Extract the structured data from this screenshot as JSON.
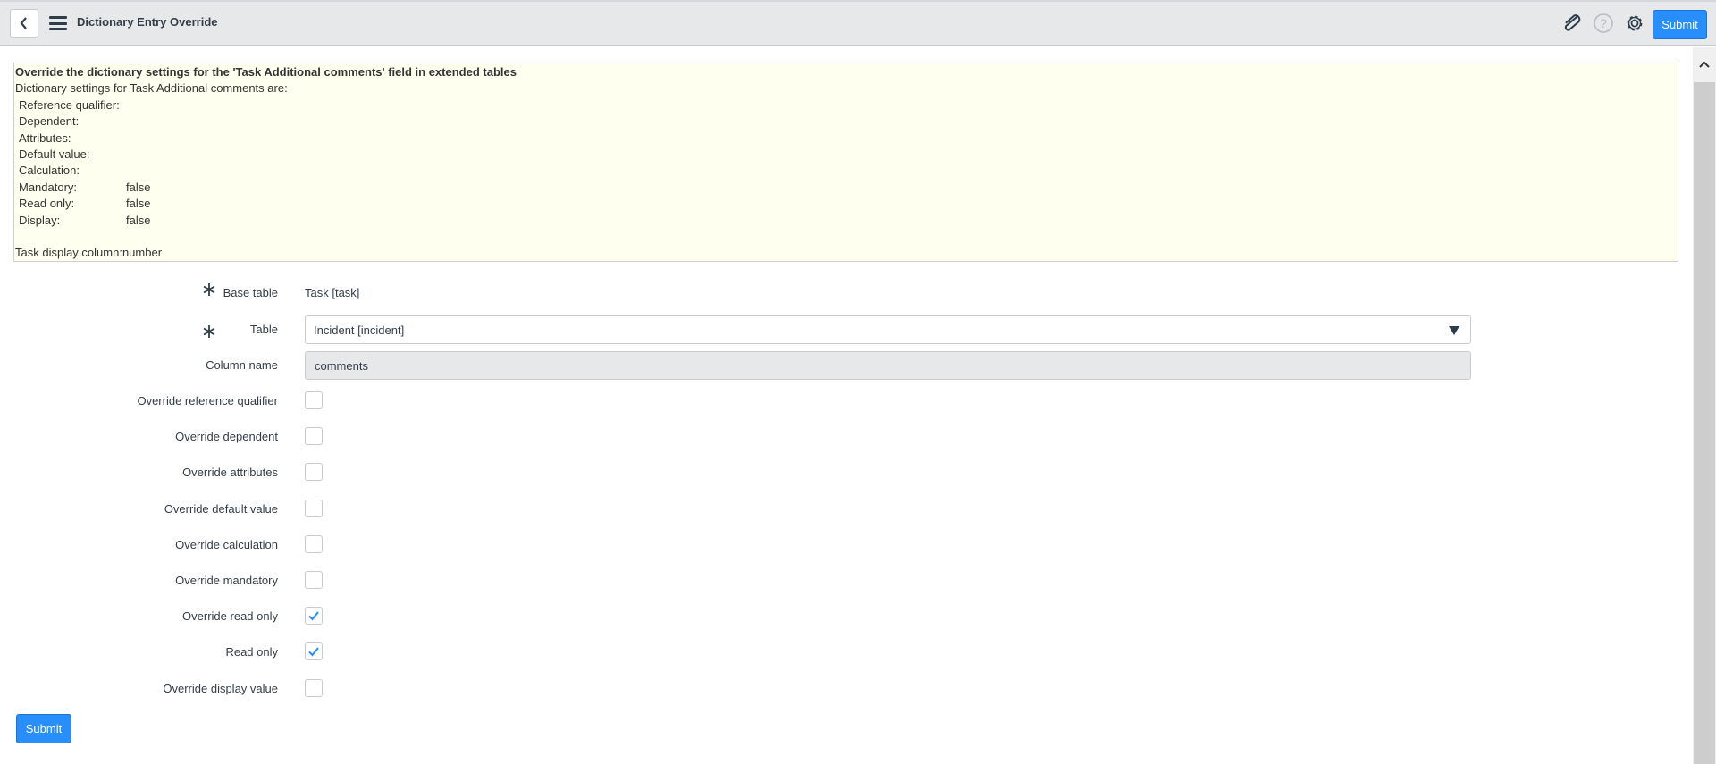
{
  "header": {
    "title": "Dictionary Entry Override",
    "submit_label": "Submit",
    "icons": [
      "back-icon",
      "menu-icon",
      "attachment-icon",
      "help-icon",
      "gear-icon"
    ]
  },
  "info": {
    "heading": "Override the dictionary settings for the 'Task Additional comments' field in extended tables",
    "intro": "Dictionary settings for Task Additional comments are:",
    "settings": [
      {
        "key": "Reference qualifier:",
        "value": ""
      },
      {
        "key": "Dependent:",
        "value": ""
      },
      {
        "key": "Attributes:",
        "value": ""
      },
      {
        "key": "Default value:",
        "value": ""
      },
      {
        "key": "Calculation:",
        "value": ""
      },
      {
        "key": "Mandatory:",
        "value": "false"
      },
      {
        "key": "Read only:",
        "value": "false"
      },
      {
        "key": "Display:",
        "value": "false"
      }
    ],
    "footer": "Task display column:number"
  },
  "form": {
    "base_table": {
      "label": "Base table",
      "value": "Task [task]"
    },
    "table": {
      "label": "Table",
      "value": "Incident [incident]"
    },
    "column_name": {
      "label": "Column name",
      "value": "comments"
    },
    "checkboxes": [
      {
        "label": "Override reference qualifier",
        "checked": false
      },
      {
        "label": "Override dependent",
        "checked": false
      },
      {
        "label": "Override attributes",
        "checked": false
      },
      {
        "label": "Override default value",
        "checked": false
      },
      {
        "label": "Override calculation",
        "checked": false
      },
      {
        "label": "Override mandatory",
        "checked": false
      },
      {
        "label": "Override read only",
        "checked": true
      },
      {
        "label": "Read only",
        "checked": true
      },
      {
        "label": "Override display value",
        "checked": false
      }
    ],
    "submit_label": "Submit"
  },
  "colors": {
    "accent": "#278efc",
    "info_bg": "#ffffef",
    "header_bg": "#e6e8ea"
  }
}
